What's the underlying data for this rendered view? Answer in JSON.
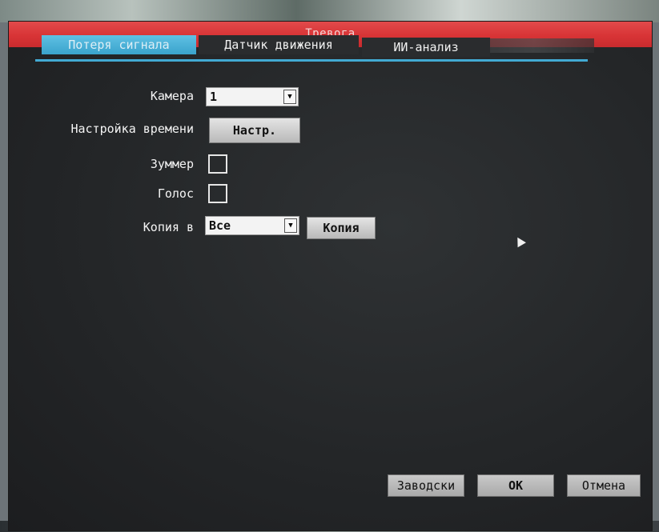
{
  "dialog": {
    "title": "Тревога"
  },
  "tabs": [
    {
      "label": "Потеря сигнала",
      "active": true
    },
    {
      "label": "Датчик движения",
      "active": false
    },
    {
      "label": "ИИ-анализ",
      "active": false
    }
  ],
  "form": {
    "camera": {
      "label": "Камера",
      "value": "1"
    },
    "time_setting": {
      "label": "Настройка времени",
      "button": "Настр."
    },
    "buzzer": {
      "label": "Зуммер",
      "checked": false
    },
    "voice": {
      "label": "Голос",
      "checked": false
    },
    "copy_to": {
      "label": "Копия в",
      "value": "Все",
      "button": "Копия"
    }
  },
  "footer": {
    "defaults": "Заводски",
    "ok": "OK",
    "cancel": "Отмена"
  },
  "colors": {
    "title_bar": "#d83436",
    "tab_active": "#42aad3",
    "dialog_bg": "#252729"
  },
  "icons": {
    "dropdown": "triangle-down",
    "cursor": "mouse-pointer"
  }
}
